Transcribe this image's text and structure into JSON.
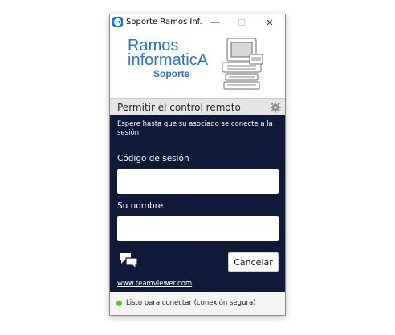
{
  "window": {
    "title": "Soporte Ramos Inf...",
    "minimize_glyph": "—",
    "maximize_glyph": "☐",
    "close_glyph": "✕"
  },
  "banner": {
    "logo_line1": "Ramos",
    "logo_line2": "informaticA",
    "logo_line3": "Soporte",
    "logo_color": "#2a73c4"
  },
  "section": {
    "title": "Permitir el control remoto",
    "settings_icon": "gear-icon"
  },
  "panel": {
    "background": "#0f1938",
    "wait_message": "Espere hasta que su asociado se conecte a la sesión.",
    "session_code_label": "Código de sesión",
    "session_code_value": "",
    "name_label": "Su nombre",
    "name_value": "",
    "chat_icon": "chat-icon",
    "cancel_label": "Cancelar",
    "link_text": "www.teamviewer.com"
  },
  "status": {
    "text": "Listo para conectar (conexión segura)",
    "color": "#5bc236"
  }
}
